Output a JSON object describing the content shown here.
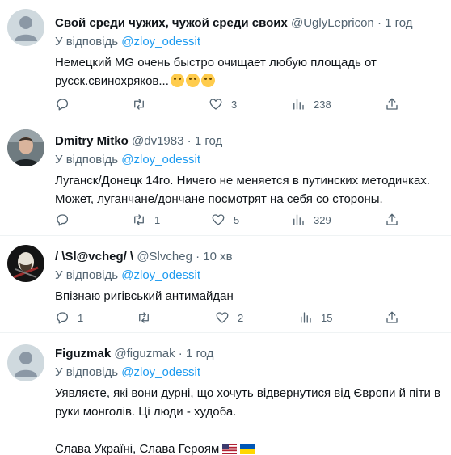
{
  "icons": {
    "reply": "comment-icon",
    "retweet": "retweet-icon",
    "like": "heart-icon",
    "views": "analytics-icon",
    "share": "share-icon"
  },
  "colors": {
    "mention": "#1d9bf0",
    "secondary": "#536471",
    "text": "#0f1419",
    "divider": "#eff3f4"
  },
  "tweets": [
    {
      "name": "Свой среди чужих, чужой среди своих",
      "handle": "@UglyLepricon",
      "dot": "·",
      "time": "1 год",
      "reply_prefix": "У відповідь",
      "reply_to": "@zloy_odessit",
      "text": "Немецкий MG очень быстро очищает любую площадь от русск.свинохряков...",
      "emojis": [
        "grinning-sweat-emoji",
        "grinning-squinting-emoji",
        "tears-of-joy-emoji"
      ],
      "replies": "",
      "retweets": "",
      "likes": "3",
      "views": "238"
    },
    {
      "name": "Dmitry Mitko",
      "handle": "@dv1983",
      "dot": "·",
      "time": "1 год",
      "reply_prefix": "У відповідь",
      "reply_to": "@zloy_odessit",
      "text": "Луганск/Донецк 14го. Ничего не меняется в путинских методичках. Может, луганчане/дончане посмотрят на себя со стороны.",
      "replies": "",
      "retweets": "1",
      "likes": "5",
      "views": "329"
    },
    {
      "name": "/ \\Sl@vcheg/ \\",
      "handle": "@Slvcheg",
      "dot": "·",
      "time": "10 хв",
      "reply_prefix": "У відповідь",
      "reply_to": "@zloy_odessit",
      "text": "Впізнаю ригівський антимайдан",
      "replies": "1",
      "retweets": "",
      "likes": "2",
      "views": "15"
    },
    {
      "name": "Figuzmak",
      "handle": "@figuzmak",
      "dot": "·",
      "time": "1 год",
      "reply_prefix": "У відповідь",
      "reply_to": "@zloy_odessit",
      "text": "Уявляєте, які вони дурні, що хочуть відвернутися від Європи й піти в руки монголів. Ці люди - худоба.\n\nСлава Україні, Слава Героям",
      "flags": [
        "us-flag",
        "ukraine-flag"
      ]
    }
  ]
}
